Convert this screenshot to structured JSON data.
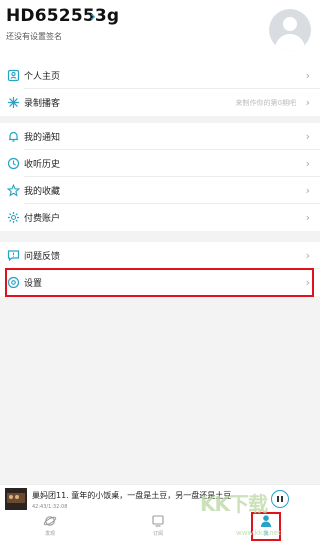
{
  "header": {
    "username": "HD652553g",
    "signature": "还没有设置签名"
  },
  "menu_groups": [
    [
      {
        "id": "homepage",
        "label": "个人主页",
        "icon": "person-card-icon",
        "hint": ""
      },
      {
        "id": "record",
        "label": "录制播客",
        "icon": "record-star-icon",
        "hint": "来制作你的第0期吧"
      }
    ],
    [
      {
        "id": "notify",
        "label": "我的通知",
        "icon": "bell-icon",
        "hint": ""
      },
      {
        "id": "history",
        "label": "收听历史",
        "icon": "clock-icon",
        "hint": ""
      },
      {
        "id": "favorite",
        "label": "我的收藏",
        "icon": "star-icon",
        "hint": ""
      },
      {
        "id": "payment",
        "label": "付费账户",
        "icon": "gear-icon",
        "hint": ""
      }
    ],
    [
      {
        "id": "feedback",
        "label": "问题反馈",
        "icon": "feedback-icon",
        "hint": ""
      },
      {
        "id": "settings",
        "label": "设置",
        "icon": "settings-icon",
        "hint": ""
      }
    ]
  ],
  "player": {
    "title": "巢妈团11. 童年的小饭桌，一盘是土豆，另一盘还是土豆",
    "time": "42:43/1:32:08"
  },
  "tabs": [
    {
      "label": "发现"
    },
    {
      "label": "订阅"
    },
    {
      "label": "我"
    }
  ],
  "watermark": {
    "text": "KK下载",
    "sub": "www.kkx.net"
  },
  "colors": {
    "accent": "#26a3c6",
    "highlight": "#e0131c"
  }
}
